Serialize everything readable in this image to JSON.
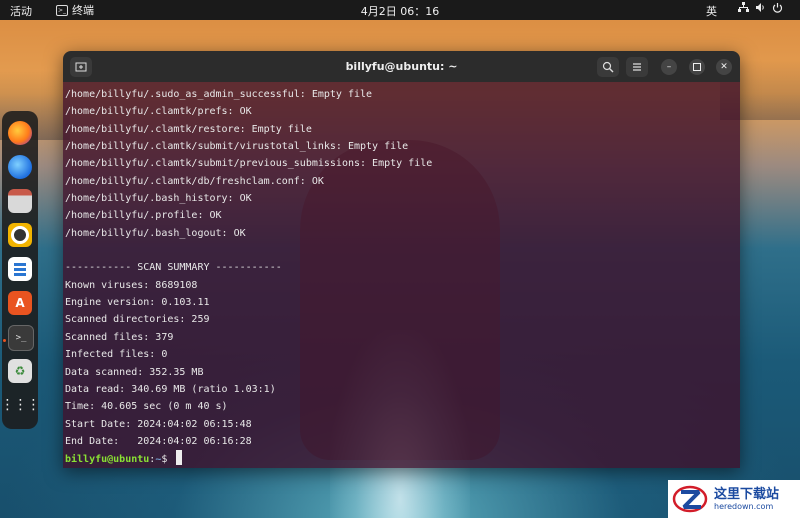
{
  "topbar": {
    "activities": "活动",
    "app_name": "终端",
    "clock": "4月2日  06：16",
    "input_method": "英",
    "icons": [
      "network-icon",
      "volume-icon",
      "power-icon"
    ]
  },
  "dock": {
    "items": [
      "firefox",
      "thunderbird",
      "files",
      "rhythmbox",
      "libreoffice-writer",
      "app-center",
      "terminal",
      "trash",
      "show-apps"
    ]
  },
  "window": {
    "title": "billyfu@ubuntu: ~"
  },
  "terminal": {
    "lines": [
      "/home/billyfu/.sudo_as_admin_successful: Empty file",
      "/home/billyfu/.clamtk/prefs: OK",
      "/home/billyfu/.clamtk/restore: Empty file",
      "/home/billyfu/.clamtk/submit/virustotal_links: Empty file",
      "/home/billyfu/.clamtk/submit/previous_submissions: Empty file",
      "/home/billyfu/.clamtk/db/freshclam.conf: OK",
      "/home/billyfu/.bash_history: OK",
      "/home/billyfu/.profile: OK",
      "/home/billyfu/.bash_logout: OK",
      "",
      "----------- SCAN SUMMARY -----------",
      "Known viruses: 8689108",
      "Engine version: 0.103.11",
      "Scanned directories: 259",
      "Scanned files: 379",
      "Infected files: 0",
      "Data scanned: 352.35 MB",
      "Data read: 340.69 MB (ratio 1.03:1)",
      "Time: 40.605 sec (0 m 40 s)",
      "Start Date: 2024:04:02 06:15:48",
      "End Date:   2024:04:02 06:16:28"
    ],
    "prompt_user": "billyfu@ubuntu",
    "prompt_sep": ":",
    "prompt_path": "~",
    "prompt_symbol": "$ "
  },
  "watermark": {
    "title": "这里下载站",
    "subtitle": "heredown.com"
  }
}
